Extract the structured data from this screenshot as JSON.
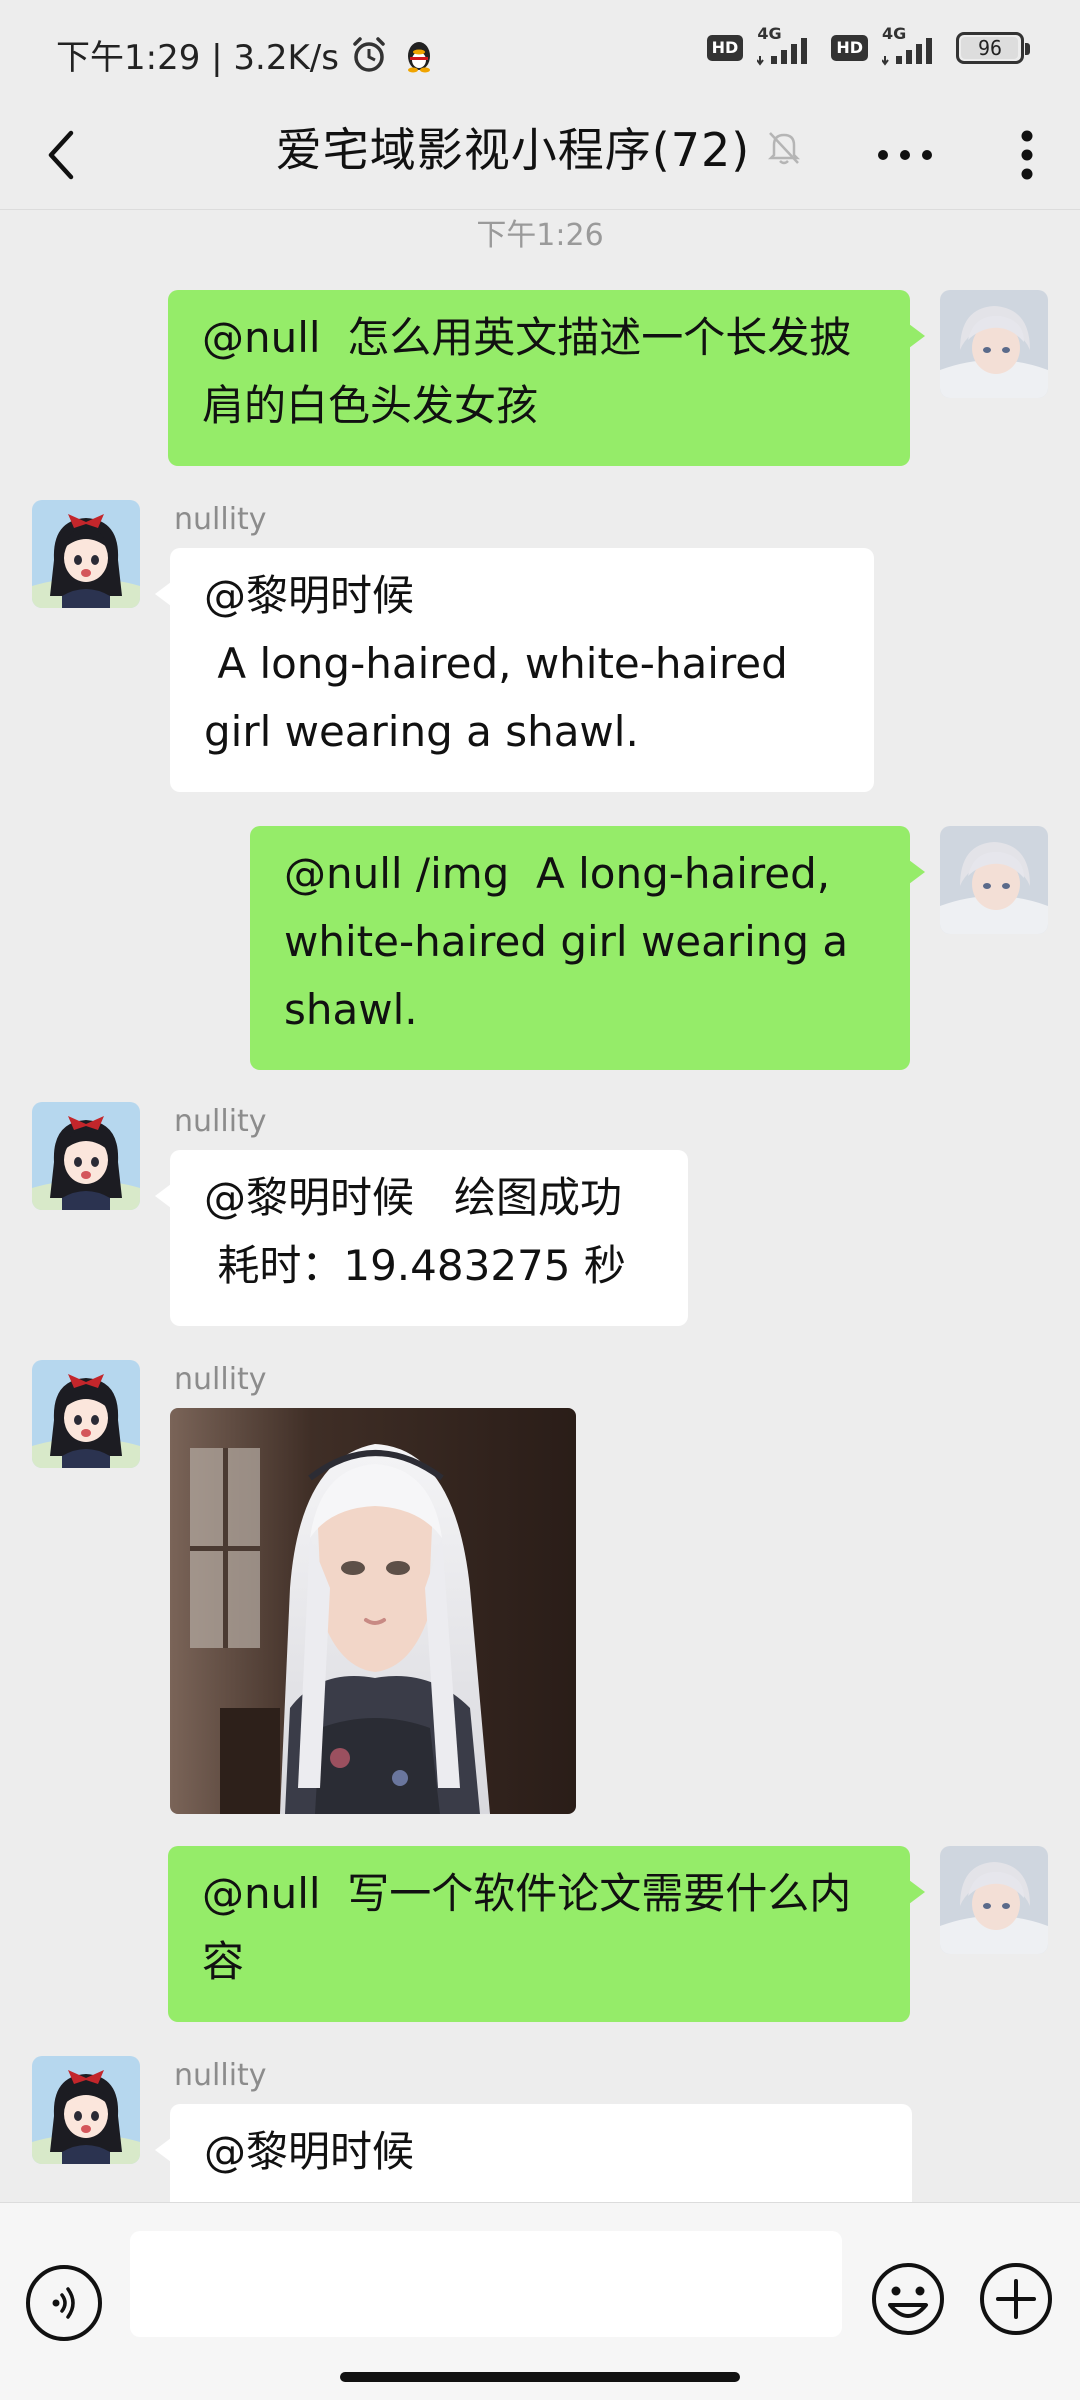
{
  "status_bar": {
    "time_speed": "下午1:29 | 3.2K/s",
    "alarm_icon": "alarm-clock-icon",
    "qq_icon": "qq-penguin-icon",
    "hd1": "HD",
    "net1": "4G",
    "hd2": "HD",
    "net2": "4G",
    "battery": "96"
  },
  "nav": {
    "title": "爱宅域影视小程序(72)",
    "back_icon": "chevron-left-icon",
    "muted_icon": "bell-off-icon",
    "more_icon": "ellipsis-icon",
    "menu_icon": "vertical-dots-icon"
  },
  "chat": {
    "timestamp": "下午1:26",
    "messages": [
      {
        "side": "out",
        "text": "@null  怎么用英文描述一个长发披肩的白色头发女孩"
      },
      {
        "side": "in",
        "sender": "nullity",
        "text": "@黎明时候\n A long-haired, white-haired girl wearing a shawl."
      },
      {
        "side": "out",
        "text": "@null /img  A long-haired, white-haired girl wearing a shawl."
      },
      {
        "side": "in",
        "sender": "nullity",
        "text": "@黎明时候   绘图成功\n 耗时：19.483275 秒"
      },
      {
        "side": "in",
        "sender": "nullity",
        "type": "image"
      },
      {
        "side": "out",
        "text": "@null  写一个软件论文需要什么内容"
      },
      {
        "side": "in",
        "sender": "nullity",
        "text": "@黎明时候"
      }
    ]
  },
  "input_bar": {
    "voice_icon": "voice-icon",
    "emoji_icon": "smiley-icon",
    "plus_icon": "plus-circle-icon",
    "placeholder": ""
  },
  "colors": {
    "background": "#ededed",
    "outgoing_bubble": "#95ec69",
    "incoming_bubble": "#ffffff"
  }
}
